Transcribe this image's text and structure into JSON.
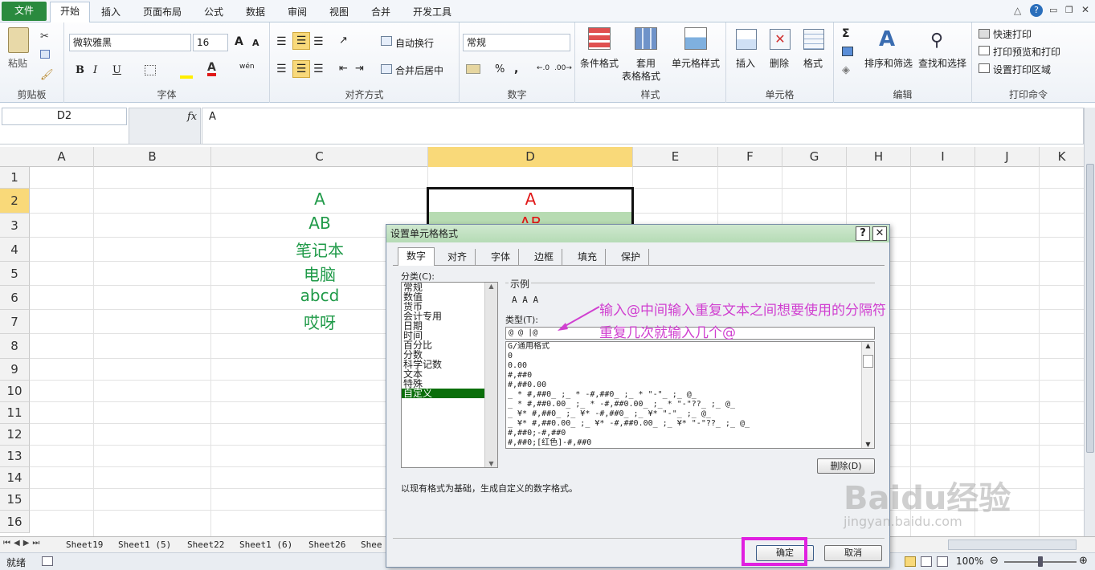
{
  "ribbon": {
    "tabs": [
      "文件",
      "开始",
      "插入",
      "页面布局",
      "公式",
      "数据",
      "审阅",
      "视图",
      "合并",
      "开发工具"
    ],
    "clipboard": {
      "paste_label": "粘贴",
      "group_label": "剪贴板"
    },
    "font": {
      "name": "微软雅黑",
      "size": "16",
      "group_label": "字体",
      "bold": "B",
      "italic": "I",
      "underline": "U",
      "grow": "A",
      "shrink": "A",
      "phonetic": "wén"
    },
    "align": {
      "wrap_label": "自动换行",
      "merge_label": "合并后居中",
      "group_label": "对齐方式"
    },
    "number": {
      "format": "常规",
      "percent": "%",
      "comma": ",",
      "group_label": "数字"
    },
    "styles": {
      "cond_label": "条件格式",
      "table_label1": "套用",
      "table_label2": "表格格式",
      "cell_label": "单元格样式",
      "group_label": "样式"
    },
    "cells": {
      "insert_label": "插入",
      "delete_label": "删除",
      "format_label": "格式",
      "group_label": "单元格"
    },
    "editing": {
      "sort_label": "排序和筛选",
      "find_label": "查找和选择",
      "sum_symbol": "Σ",
      "group_label": "编辑"
    },
    "print": {
      "quick": "快速打印",
      "preview": "打印预览和打印",
      "area": "设置打印区域",
      "group_label": "打印命令"
    }
  },
  "formula_bar": {
    "name_box": "D2",
    "fx": "fx",
    "content": "A"
  },
  "columns": [
    "A",
    "B",
    "C",
    "D",
    "E",
    "F",
    "G",
    "H",
    "I",
    "J",
    "K"
  ],
  "rows": [
    "1",
    "2",
    "3",
    "4",
    "5",
    "6",
    "7",
    "8",
    "9",
    "10",
    "11",
    "12",
    "13",
    "14",
    "15",
    "16"
  ],
  "cells": {
    "C2": "A",
    "C3": "AB",
    "C4": "笔记本",
    "C5": "电脑",
    "C6": "abcd",
    "C7": "哎呀",
    "D2": "A",
    "D3": "AB"
  },
  "sheet_tabs": [
    "Sheet19",
    "Sheet1 (5)",
    "Sheet22",
    "Sheet1 (6)",
    "Sheet26",
    "Shee"
  ],
  "status": {
    "ready": "就绪",
    "zoom": "100%"
  },
  "dialog": {
    "title": "设置单元格格式",
    "help": "?",
    "close": "✕",
    "tabs": [
      "数字",
      "对齐",
      "字体",
      "边框",
      "填充",
      "保护"
    ],
    "category_label": "分类(C):",
    "categories": [
      "常规",
      "数值",
      "货币",
      "会计专用",
      "日期",
      "时间",
      "百分比",
      "分数",
      "科学记数",
      "文本",
      "特殊",
      "自定义"
    ],
    "selected_category": "自定义",
    "sample_label": "示例",
    "sample_value": "A  A  A",
    "type_label": "类型(T):",
    "type_value": "@  @  |@",
    "formats": [
      "G/通用格式",
      "0",
      "0.00",
      "#,##0",
      "#,##0.00",
      "_ * #,##0_ ;_ * -#,##0_ ;_ * \"-\"_ ;_ @_",
      "_ * #,##0.00_ ;_ * -#,##0.00_ ;_ * \"-\"??_ ;_ @_",
      "_ ¥* #,##0_ ;_ ¥* -#,##0_ ;_ ¥* \"-\"_ ;_ @_",
      "_ ¥* #,##0.00_ ;_ ¥* -#,##0.00_ ;_ ¥* \"-\"??_ ;_ @_",
      "#,##0;-#,##0",
      "#,##0;[红色]-#,##0"
    ],
    "delete_button": "删除(D)",
    "description": "以现有格式为基础，生成自定义的数字格式。",
    "ok": "确定",
    "cancel": "取消"
  },
  "annotation": {
    "line1": "输入@中间输入重复文本之间想要使用的分隔符",
    "line2": "重复几次就输入几个@"
  },
  "watermark": {
    "brand": "Baidu经验",
    "url": "jingyan.baidu.com"
  },
  "colors": {
    "green_text": "#1f9a48",
    "red_text": "#e01818",
    "accent_box": "#e020e0",
    "selected_cat": "#0a6e0a"
  }
}
